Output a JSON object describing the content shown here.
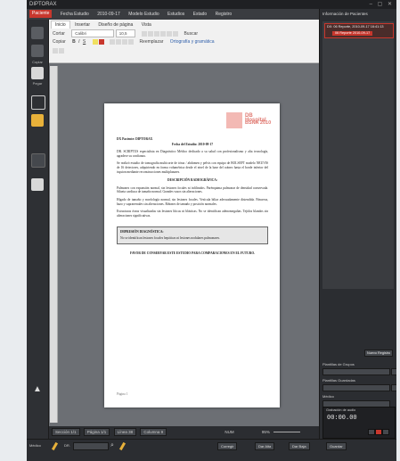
{
  "window": {
    "title": "DIPTORAX"
  },
  "menubar": {
    "tag": "Paciente",
    "items": [
      "Fecha Estudio",
      "2010-09-17",
      "Modelo Estudio",
      "Estudios",
      "Estado",
      "Registro"
    ]
  },
  "leftbar": {
    "items": [
      {
        "label": "Copiar"
      },
      {
        "label": "Pegar"
      }
    ]
  },
  "ribbon": {
    "tabs": [
      "Inicio",
      "Insertar",
      "Diseño de página",
      "Vista"
    ],
    "font_name": "Calibri",
    "font_size": "10,5",
    "cut_label": "Cortar",
    "copy_label": "Copiar",
    "group_labels": [
      "Buscar",
      "Reemplazar",
      "Ortografía y gramática"
    ]
  },
  "document": {
    "logo_line1": "DB Hospital",
    "logo_line2": "BSNA 2010",
    "patient_label": "DX Paciente: DIPTORAX",
    "date_line": "Fecha del Estudio: 2010-09-17",
    "intro": "DR. SCRIPTUS especialista en Diagnóstico Médico dedicado a su salud con profesionalismo y alta tecnología, agradece su confianza.",
    "body1": "Se realizó estudio de tomografía multicorte de tórax / abdomen y pelvis con equipo de BOLSEFT modelo NEUVIS de 16 detectores, adquiriendo en forma volumétrica desde el nivel de la base del cráneo hasta el borde inferior del isquion mediante reconstrucciones multiplanares.",
    "section_title": "DESCRIPCIÓN RADIOGRÁFICA:",
    "body2": "Pulmones con expansión normal, sin lesiones focales ni infiltrados. Parénquima pulmonar de densidad conservada. Silueta cardiaca de tamaño normal. Grandes vasos sin alteraciones.",
    "body3": "Hígado de tamaño y morfología normal, sin lesiones focales. Vesícula biliar adecuadamente distendida. Páncreas, bazo y suprarrenales sin alteraciones. Riñones de tamaño y posición normales.",
    "body4": "Estructuras óseas visualizadas sin lesiones líticas ni blásticas. No se identifican adenomegalias. Tejidos blandos sin alteraciones significativas.",
    "impression_title": "IMPRESIÓN DIAGNÓSTICA:",
    "impression_body": "No se identifican lesiones focales hepáticas ni lesiones nodulares pulmonares.",
    "footer_note": "FAVOR DE CONSERVAR ESTE ESTUDIO PARA COMPARACIONES EN EL FUTURO.",
    "page_label": "Página 1"
  },
  "status": {
    "section": "Sección 1/1",
    "page": "Página 1/1",
    "line": "Línea 38",
    "column": "Columna 9",
    "mode": "NUM",
    "zoom": "95%"
  },
  "right_panel": {
    "title": "Información de Pacientes",
    "item_title": "DX: 06 Reporte, 2010-09-17 16:41:13",
    "item_badge": "06 Reporte  2010-09-17",
    "new_button": "Nuevo Registro",
    "sections": [
      "Plantillas de Grupos",
      "Plantillas Guardadas",
      "Médico"
    ],
    "audio_label": "Grabación de audio",
    "audio_time": "00:00.00"
  },
  "bottom": {
    "tool_label": "Médico",
    "field_label": "DR.",
    "buttons": [
      "Corregir",
      "Dar Alta",
      "Dar Baja",
      "Guardar"
    ]
  }
}
